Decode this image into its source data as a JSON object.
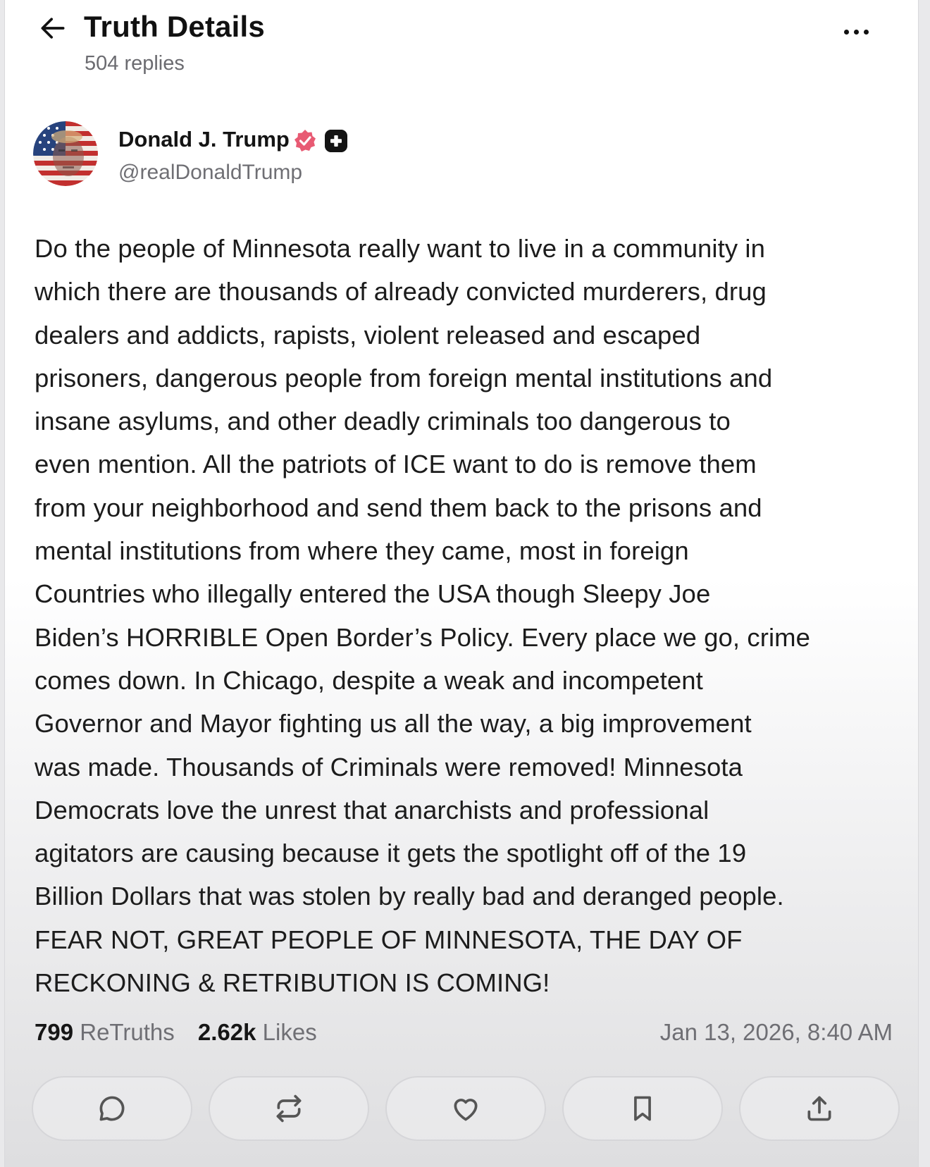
{
  "header": {
    "title": "Truth Details",
    "replies": "504 replies"
  },
  "author": {
    "name": "Donald J. Trump",
    "handle": "@realDonaldTrump",
    "verified_color": "#e85a73"
  },
  "post": {
    "text": "Do the people of Minnesota really want to live in a community in which there are thousands of already convicted murderers, drug dealers and addicts, rapists, violent released and escaped prisoners, dangerous people from foreign mental institutions and insane asylums, and other deadly criminals too dangerous to even mention. All the patriots of ICE want to do is remove them from your neighborhood and send them back to the prisons and mental institutions from where they came, most in foreign Countries who illegally entered the USA though Sleepy Joe Biden’s HORRIBLE Open Border’s Policy. Every place we go, crime comes down. In Chicago, despite a weak and incompetent Governor and Mayor fighting us all the way, a big improvement was made. Thousands of Criminals were removed! Minnesota Democrats love the unrest that anarchists and professional agitators are causing because it gets the spotlight off of the 19 Billion Dollars that was stolen by really bad and deranged people. FEAR NOT, GREAT PEOPLE OF MINNESOTA, THE DAY OF RECKONING & RETRIBUTION IS COMING!",
    "lines": [
      "Do the people of Minnesota really want to live in a community in",
      "which there are thousands of already convicted murderers, drug",
      "dealers and addicts, rapists, violent released and escaped",
      "prisoners, dangerous people from foreign mental institutions and",
      "insane asylums, and other deadly criminals too dangerous to",
      "even mention. All the patriots of ICE want to do is remove them",
      "from your neighborhood and send them back to the prisons and",
      "mental institutions from where they came, most in foreign",
      "Countries who illegally entered the USA though Sleepy Joe",
      "Biden’s HORRIBLE Open Border’s Policy. Every place we go, crime",
      "comes down. In Chicago, despite a weak and incompetent",
      "Governor and Mayor fighting us all the way, a big improvement",
      "was made. Thousands of Criminals were removed! Minnesota",
      "Democrats love the unrest that anarchists and professional",
      "agitators are causing because it gets the spotlight off of the 19",
      "Billion Dollars that was stolen by really bad and deranged people.",
      "FEAR NOT, GREAT PEOPLE OF MINNESOTA, THE DAY OF",
      "RECKONING & RETRIBUTION IS COMING!"
    ]
  },
  "stats": {
    "retruths_count": "799",
    "retruths_label": "ReTruths",
    "likes_count": "2.62k",
    "likes_label": "Likes",
    "timestamp": "Jan 13, 2026, 8:40 AM"
  },
  "actions": [
    {
      "icon": "reply-icon"
    },
    {
      "icon": "retruth-icon"
    },
    {
      "icon": "heart-icon"
    },
    {
      "icon": "bookmark-icon"
    },
    {
      "icon": "share-icon"
    }
  ]
}
